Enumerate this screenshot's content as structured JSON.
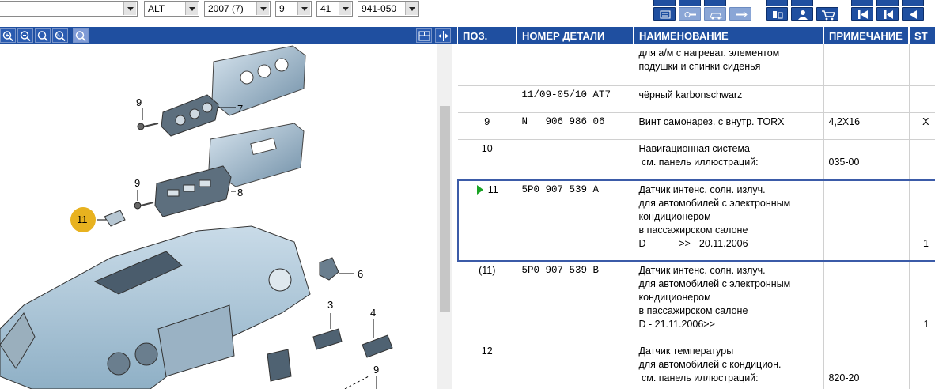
{
  "filters": [
    {
      "value": ""
    },
    {
      "value": "ALT"
    },
    {
      "value": "2007 (7)"
    },
    {
      "value": "9"
    },
    {
      "value": "41"
    },
    {
      "value": "941-050"
    }
  ],
  "toolbar_icons": [
    "list-icon",
    "key-icon",
    "car-icon",
    "arrow-icon",
    "parts-icon",
    "user-icon",
    "cart-icon",
    "first-icon",
    "prev-section-icon",
    "prev-icon"
  ],
  "zoom_tools": [
    "zoom-in-icon",
    "zoom-out-icon",
    "zoom-area-icon",
    "zoom-100-icon",
    "zoom-fit-icon"
  ],
  "diagram": {
    "callouts": [
      "9",
      "7",
      "9",
      "8",
      "11",
      "6",
      "3",
      "4",
      "9"
    ],
    "highlight_color": "#e8b21f"
  },
  "table": {
    "headers": [
      "ПОЗ.",
      "НОМЕР ДЕТАЛИ",
      "НАИМЕНОВАНИЕ",
      "ПРИМЕЧАНИЕ",
      "ST"
    ],
    "rows": [
      {
        "pos": "",
        "pn": "",
        "name": "для а/м с нагреват. элементом\nподушки и спинки сиденья",
        "note": "",
        "st": ""
      },
      {
        "pos": "",
        "pn": "11/09-05/10 AT7",
        "name": "чёрный karbonschwarz",
        "note": "",
        "st": ""
      },
      {
        "pos": "9",
        "pn": "N   906 986 06",
        "name": "Винт самонарез. с внутр. TORX",
        "note": "4,2X16",
        "st": "X"
      },
      {
        "pos": "10",
        "pn": "",
        "name": "Навигационная система\n см. панель иллюстраций:",
        "note": "\n035-00",
        "st": ""
      },
      {
        "pos": "11",
        "pn": "5P0 907 539 A",
        "name": "Датчик интенс. солн. излуч.\nдля автомобилей с электронным\nкондиционером\nв пассажирском салоне\nD            >> - 20.11.2006",
        "note": "",
        "st": "\n\n\n\n1"
      },
      {
        "pos": "(11)",
        "pn": "5P0 907 539 B",
        "name": "Датчик интенс. солн. излуч.\nдля автомобилей с электронным\nкондиционером\nв пассажирском салоне\nD - 21.11.2006>>",
        "note": "",
        "st": "\n\n\n\n1"
      },
      {
        "pos": "12",
        "pn": "",
        "name": "Датчик температуры\nдля автомобилей с кондицион.\n см. панель иллюстраций:",
        "note": "\n\n820-20",
        "st": ""
      }
    ],
    "selected_index": 4
  }
}
